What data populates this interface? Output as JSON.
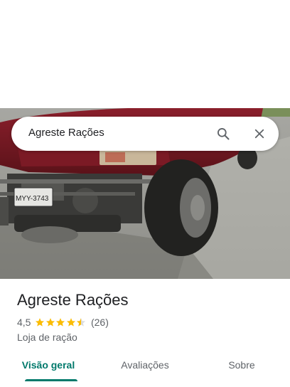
{
  "search": {
    "query": "Agreste Rações"
  },
  "place": {
    "name": "Agreste Rações",
    "rating": "4,5",
    "review_count": "(26)",
    "stars_value": 4.5,
    "category": "Loja de ração"
  },
  "tabs": [
    {
      "label": "Visão geral",
      "active": true
    },
    {
      "label": "Avaliações",
      "active": false
    },
    {
      "label": "Sobre",
      "active": false
    }
  ],
  "photo": {
    "plate_text": "MYY-3743"
  },
  "colors": {
    "accent": "#00796b",
    "star": "#fbbc04",
    "text_primary": "#202124",
    "text_secondary": "#5f6368"
  }
}
